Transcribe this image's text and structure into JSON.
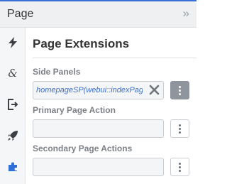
{
  "panel": {
    "title": "Page",
    "collapse_icon": "double-chevron-right-icon"
  },
  "rail": {
    "items": [
      {
        "icon": "bolt-icon",
        "active": false
      },
      {
        "icon": "ampersand-icon",
        "glyph": "&",
        "active": false
      },
      {
        "icon": "export-icon",
        "active": false
      },
      {
        "icon": "rocket-icon",
        "active": false
      },
      {
        "icon": "puzzle-icon",
        "active": true
      }
    ]
  },
  "section": {
    "title": "Page Extensions",
    "side_panels": {
      "label": "Side Panels",
      "value": "homepageSP(webui::indexPageE"
    },
    "primary_action": {
      "label": "Primary Page Action",
      "value": ""
    },
    "secondary_actions": {
      "label": "Secondary Page Actions",
      "value": ""
    }
  },
  "colors": {
    "accent": "#3b6fd8",
    "value_text": "#3f6fc4",
    "active_icon": "#2f6fd6"
  }
}
